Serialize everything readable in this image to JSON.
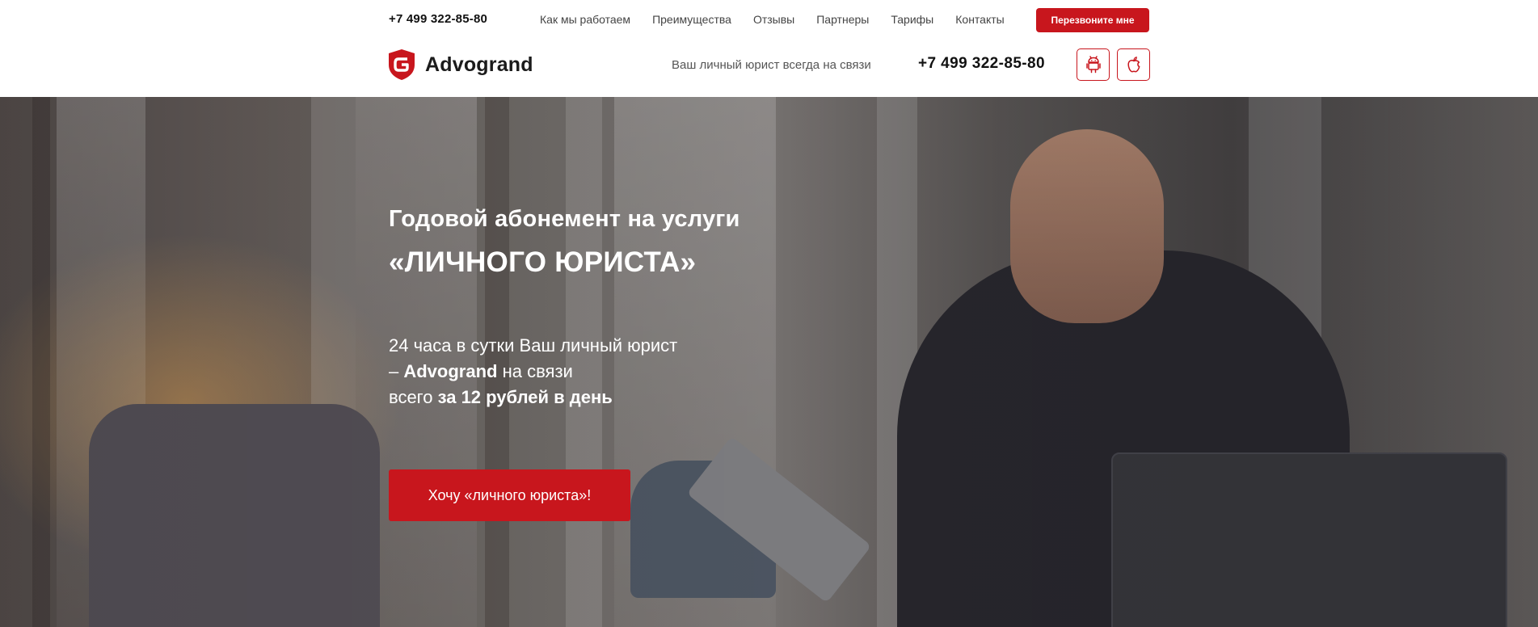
{
  "topbar": {
    "phone": "+7 499 322-85-80",
    "nav": [
      "Как мы работаем",
      "Преимущества",
      "Отзывы",
      "Партнеры",
      "Тарифы",
      "Контакты"
    ],
    "callback_label": "Перезвоните мне"
  },
  "header": {
    "logo_text": "Advogrand",
    "tagline": "Ваш личный юрист всегда на связи",
    "phone": "+7 499 322-85-80",
    "app_buttons": [
      {
        "icon": "android-icon"
      },
      {
        "icon": "apple-icon"
      }
    ]
  },
  "hero": {
    "title_line1": "Годовой абонемент на услуги",
    "title_line2": "«ЛИЧНОГО ЮРИСТА»",
    "text_line1": "24 часа в сутки Ваш личный юрист",
    "text_line2_prefix": "– ",
    "text_line2_brand": "Advogrand",
    "text_line2_suffix": " на связи",
    "text_line3_prefix": "всего ",
    "text_line3_bold": "за 12 рублей в день",
    "cta_label": "Хочу «личного юриста»!"
  },
  "colors": {
    "accent": "#c8161d",
    "text_dark": "#111111",
    "white": "#ffffff"
  }
}
